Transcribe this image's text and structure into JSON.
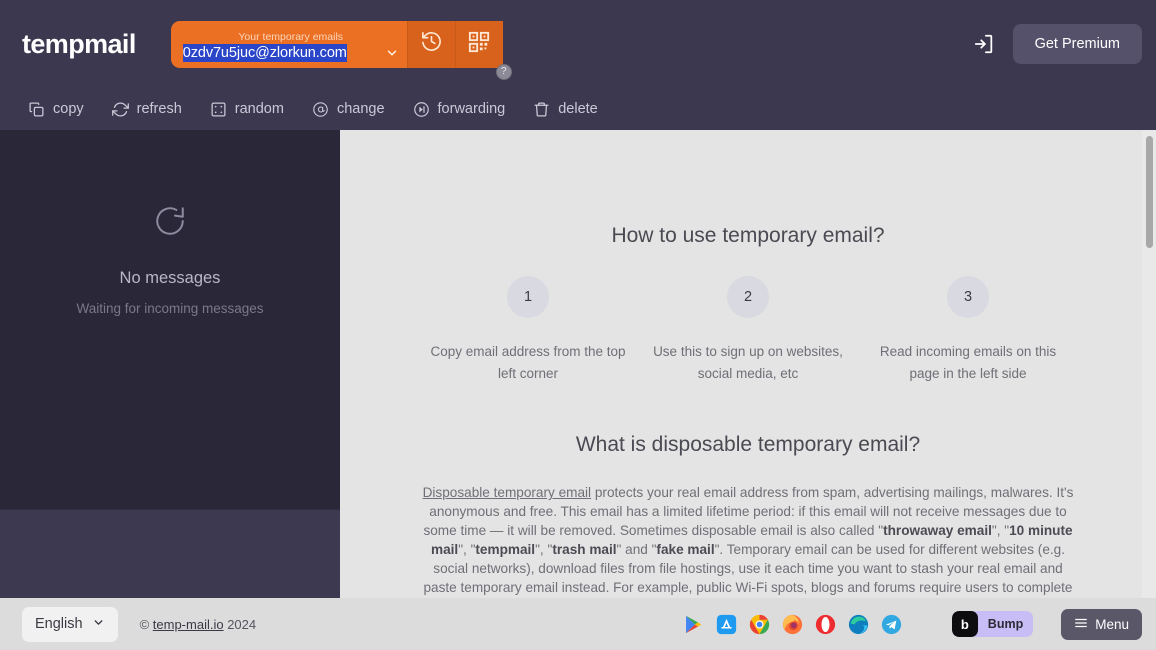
{
  "header": {
    "logo": "tempmail",
    "mail_label": "Your temporary emails",
    "mail_value": "0zdv7u5juc@zlorkun.com",
    "help_badge": "?",
    "history_icon": "history-clock-icon",
    "qr_icon": "qr-code-icon",
    "chevron_icon": "chevron-down-icon",
    "login_icon": "login-icon",
    "premium_label": "Get Premium",
    "accent_color": "#ec7023",
    "bar_color": "#3b3850"
  },
  "toolbar": {
    "items": [
      {
        "label": "copy",
        "icon": "copy-icon"
      },
      {
        "label": "refresh",
        "icon": "refresh-icon"
      },
      {
        "label": "random",
        "icon": "dice-icon"
      },
      {
        "label": "change",
        "icon": "change-at-icon"
      },
      {
        "label": "forwarding",
        "icon": "forward-icon"
      },
      {
        "label": "delete",
        "icon": "trash-icon"
      }
    ]
  },
  "sidebar": {
    "spinner_icon": "loading-spinner-icon",
    "empty_title": "No messages",
    "empty_subtitle": "Waiting for incoming messages"
  },
  "main": {
    "how_to_title": "How to use temporary email?",
    "steps": [
      {
        "num": "1",
        "text": "Copy email address from the top left corner"
      },
      {
        "num": "2",
        "text": "Use this to sign up on websites, social media, etc"
      },
      {
        "num": "3",
        "text": "Read incoming emails on this page in the left side"
      }
    ],
    "what_is_title": "What is disposable temporary email?",
    "paragraph": {
      "link": "Disposable temporary email",
      "p1": " protects your real email address from spam, advertising mailings, malwares. It's anonymous and free. This email has a limited lifetime period: if this email will not receive messages due to some time — it will be removed. Sometimes disposable email is also called \"",
      "b1": "throwaway email",
      "p2": "\", \"",
      "b2": "10 minute mail",
      "p3": "\", \"",
      "b3": "tempmail",
      "p4": "\", \"",
      "b4": "trash mail",
      "p5": "\" and \"",
      "b5": "fake mail",
      "p6": "\". Temporary email can be used for different websites (e.g. social networks), download files from file hostings, use it each time you want to stash your real email and paste temporary email instead. For example, public Wi-Fi spots, blogs and forums require users to complete registration until they can fully use their website."
    }
  },
  "footer": {
    "language": "English",
    "language_chevron": "chevron-down-icon",
    "copyright_symbol": "©",
    "copyright_link": "temp-mail.io",
    "copyright_year": "2024",
    "store_icons": [
      "google-play-icon",
      "app-store-icon",
      "chrome-icon",
      "firefox-icon",
      "opera-icon",
      "edge-icon",
      "telegram-icon"
    ],
    "bump_logo": "b",
    "bump_label": "Bump",
    "menu_label": "Menu",
    "menu_icon": "hamburger-menu-icon"
  }
}
